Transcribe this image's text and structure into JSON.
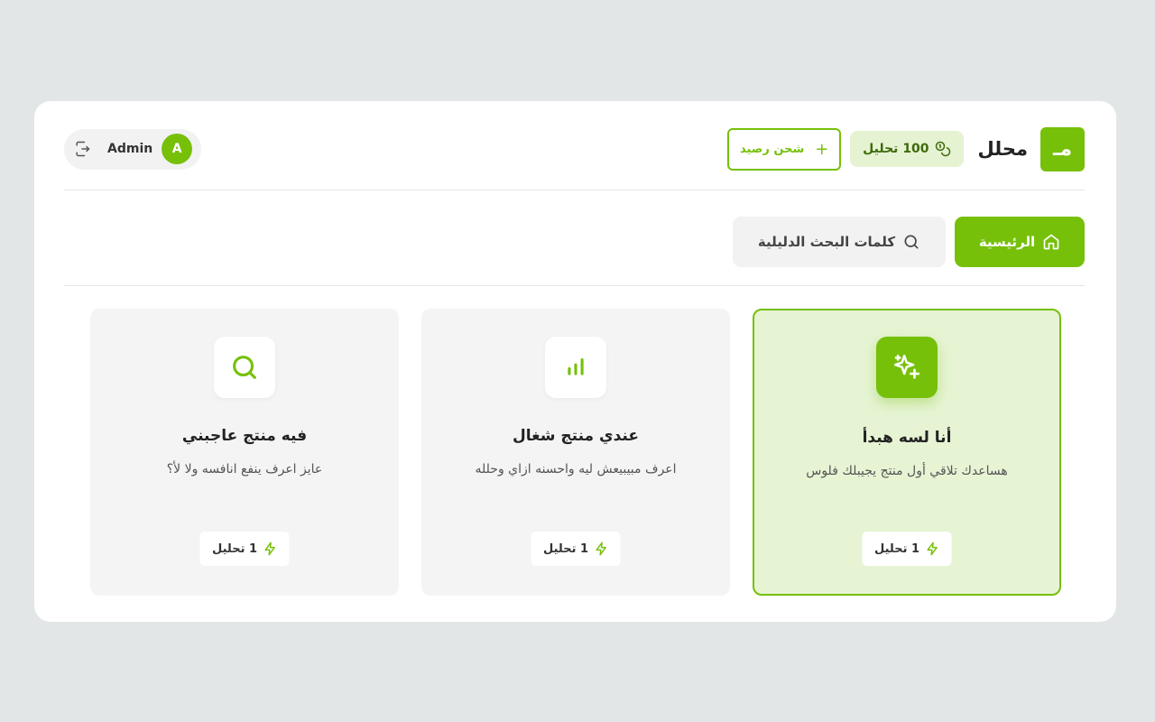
{
  "header": {
    "logo_text": "مـ",
    "brand": "محلل",
    "credits": "100 تحليل",
    "topup_label": "شحن رصيد",
    "user_initial": "A",
    "user_name": "Admin"
  },
  "nav": {
    "home_label": "الرئيسية",
    "keywords_label": "كلمات البحث الدليلية"
  },
  "cards": [
    {
      "title": "أنا لسه هبدأ",
      "desc": "هساعدك تلاقي أول منتج يجيبلك فلوس",
      "badge": "1 تحليل",
      "icon": "sparkles-icon",
      "selected": true
    },
    {
      "title": "عندي منتج شغال",
      "desc": "اعرف مبيبيعش ليه واحسنه ازاي وحلله",
      "badge": "1 تحليل",
      "icon": "bar-chart-icon",
      "selected": false
    },
    {
      "title": "فيه منتج عاجبني",
      "desc": "عايز اعرف ينفع انافسه ولا لأ؟",
      "badge": "1 تحليل",
      "icon": "search-icon",
      "selected": false
    }
  ],
  "colors": {
    "accent": "#76c00a",
    "accent_light": "#e6f4d4",
    "background": "#e3e6e7"
  }
}
